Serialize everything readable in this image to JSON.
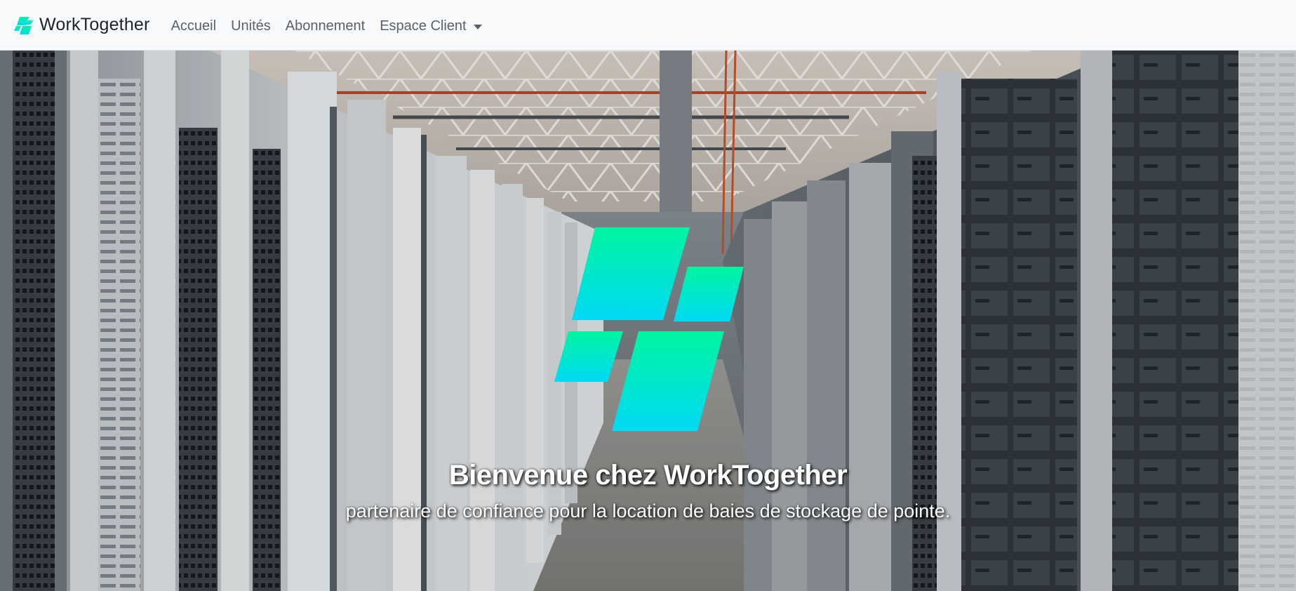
{
  "navbar": {
    "brand": "WorkTogether",
    "brand_icon": "worktogether-logo-icon",
    "links": [
      {
        "label": "Accueil"
      },
      {
        "label": "Unités"
      },
      {
        "label": "Abonnement"
      },
      {
        "label": "Espace Client",
        "dropdown": true,
        "icon": "caret-down-icon"
      }
    ]
  },
  "hero": {
    "title": "Bienvenue chez WorkTogether",
    "subtitle": "partenaire de confiance pour la location de baies de stockage de pointe.",
    "logo_icon": "worktogether-logo-icon",
    "background": "data-center-server-racks-photo"
  },
  "colors": {
    "navbar_bg": "#f8f9fa",
    "brand_text": "#212529",
    "nav_link": "#5c6166",
    "logo_gradient_top": "#00f5a0",
    "logo_gradient_bottom": "#00d9f5",
    "hero_text": "#ffffff"
  }
}
